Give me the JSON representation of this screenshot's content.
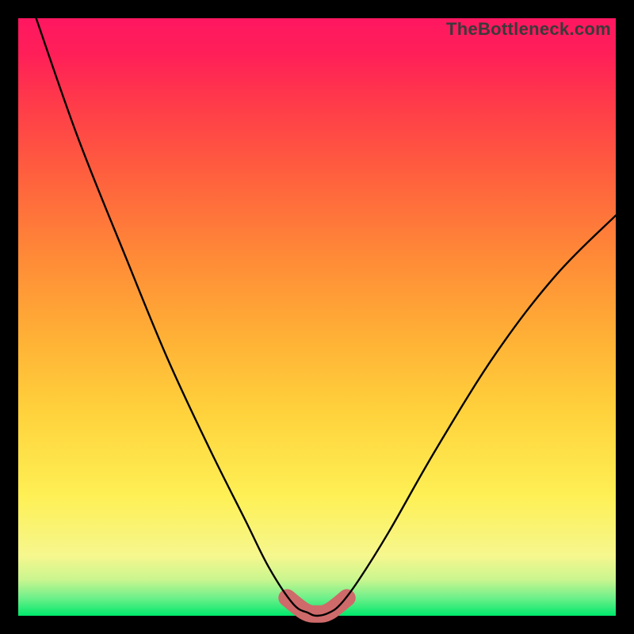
{
  "watermark": "TheBottleneck.com",
  "chart_data": {
    "type": "line",
    "title": "",
    "xlabel": "",
    "ylabel": "",
    "xlim": [
      0,
      100
    ],
    "ylim": [
      0,
      100
    ],
    "grid": false,
    "legend": false,
    "series": [
      {
        "name": "curve",
        "x": [
          3,
          10,
          18,
          25,
          32,
          38,
          42,
          46,
          48.5,
          50,
          52,
          54,
          57,
          62,
          70,
          80,
          90,
          100
        ],
        "values": [
          100,
          80,
          60,
          43,
          28,
          16,
          8,
          2,
          0.5,
          0,
          0.5,
          2,
          6,
          14,
          28,
          44,
          57,
          67
        ]
      },
      {
        "name": "highlight-band",
        "x": [
          45,
          48,
          50,
          52,
          55
        ],
        "values": [
          3,
          0.7,
          0.3,
          0.7,
          3
        ]
      }
    ],
    "colors": {
      "curve": "#000000",
      "highlight": "#cf6a6a",
      "gradient_top": "#ff1761",
      "gradient_mid": "#fef055",
      "gradient_bottom": "#00e86b"
    }
  }
}
